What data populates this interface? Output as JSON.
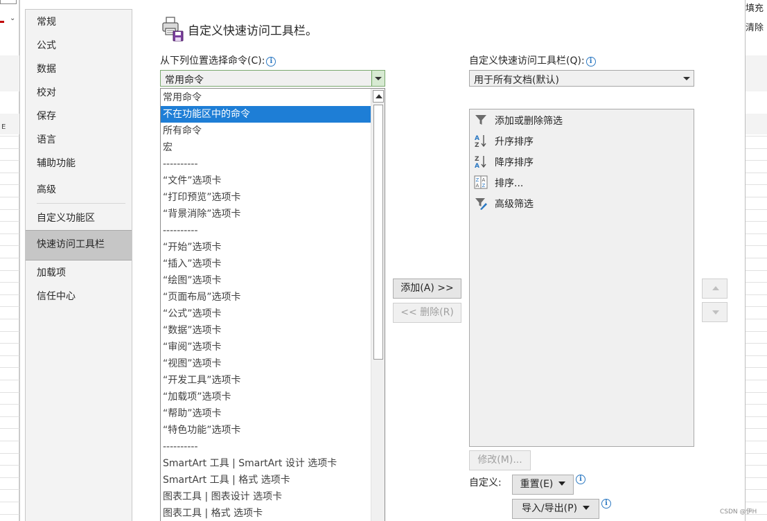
{
  "background": {
    "right_labels": [
      "填充",
      "清除"
    ],
    "column_letter": "E",
    "watermark": "CSDN @伊H"
  },
  "nav": {
    "items": [
      {
        "label": "常规"
      },
      {
        "label": "公式"
      },
      {
        "label": "数据"
      },
      {
        "label": "校对"
      },
      {
        "label": "保存"
      },
      {
        "label": "语言"
      },
      {
        "label": "辅助功能"
      },
      {
        "label": "高级"
      },
      {
        "label": "自定义功能区"
      },
      {
        "label": "快速访问工具栏",
        "active": true
      },
      {
        "label": "加载项"
      },
      {
        "label": "信任中心"
      }
    ]
  },
  "header": {
    "title": "自定义快速访问工具栏。"
  },
  "choose_from": {
    "label": "从下列位置选择命令(C):",
    "value": "常用命令",
    "options": [
      "常用命令",
      "不在功能区中的命令",
      "所有命令",
      "宏",
      "----------",
      "“文件”选项卡",
      "“打印预览”选项卡",
      "“背景消除”选项卡",
      "----------",
      "“开始”选项卡",
      "“插入”选项卡",
      "“绘图”选项卡",
      "“页面布局”选项卡",
      "“公式”选项卡",
      "“数据”选项卡",
      "“审阅”选项卡",
      "“视图”选项卡",
      "“开发工具”选项卡",
      "“加载项”选项卡",
      "“帮助”选项卡",
      "“特色功能”选项卡",
      "----------",
      "SmartArt 工具 | SmartArt 设计 选项卡",
      "SmartArt 工具 | 格式 选项卡",
      "图表工具 | 图表设计 选项卡",
      "图表工具 | 格式 选项卡"
    ],
    "highlighted": "不在功能区中的命令"
  },
  "qat": {
    "label": "自定义快速访问工具栏(Q):",
    "value": "用于所有文档(默认)",
    "items": [
      {
        "label": "添加或删除筛选",
        "icon": "filter-icon"
      },
      {
        "label": "升序排序",
        "icon": "sort-ascending-icon"
      },
      {
        "label": "降序排序",
        "icon": "sort-descending-icon"
      },
      {
        "label": "排序...",
        "icon": "sort-icon"
      },
      {
        "label": "高级筛选",
        "icon": "advanced-filter-icon"
      }
    ]
  },
  "buttons": {
    "add": "添加(A) >>",
    "remove": "<< 删除(R)",
    "modify": "修改(M)...",
    "customize_label": "自定义:",
    "reset": "重置(E)",
    "import_export": "导入/导出(P)"
  }
}
